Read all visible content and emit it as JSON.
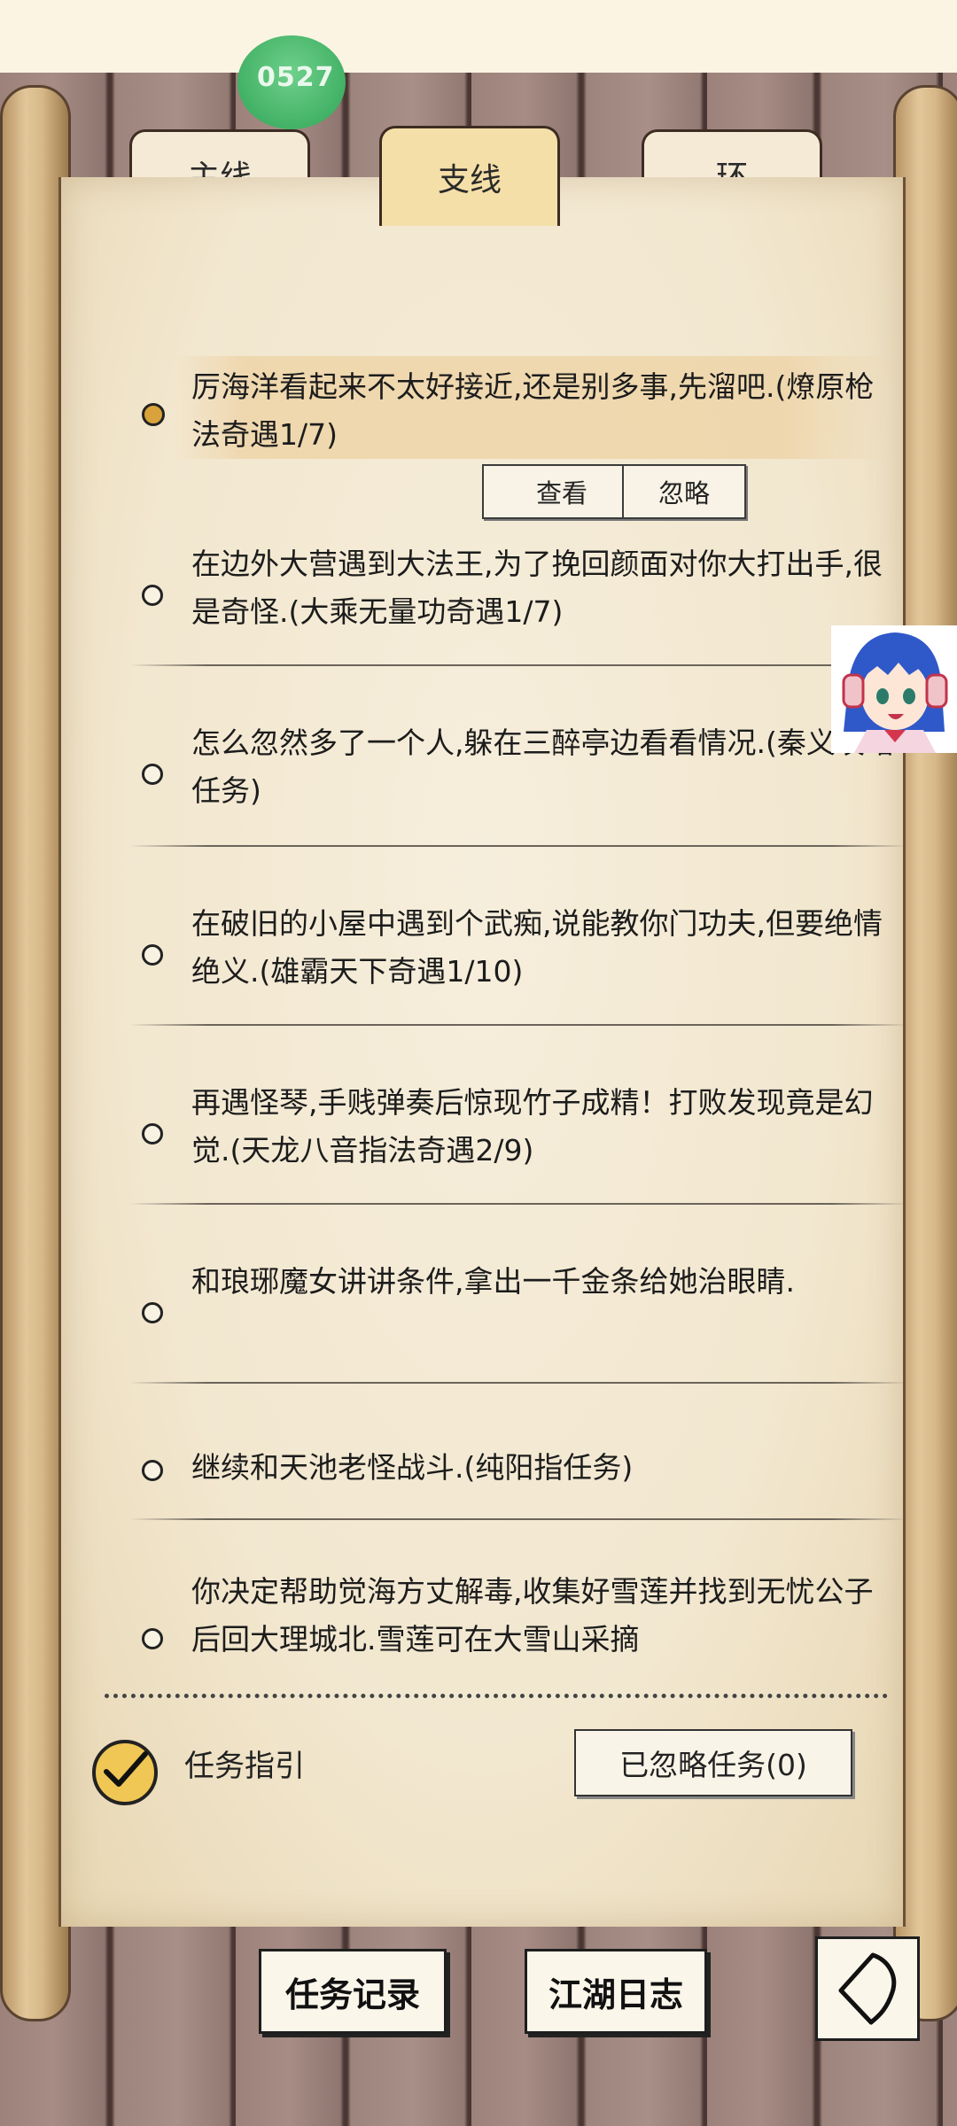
{
  "header": {
    "badge_text": "0527"
  },
  "tabs": [
    {
      "label": "主线",
      "active": false
    },
    {
      "label": "支线",
      "active": true
    },
    {
      "label": "环",
      "active": false
    }
  ],
  "quests": [
    {
      "text": "厉海洋看起来不太好接近,还是别多事,先溜吧.(燎原枪法奇遇1/7)",
      "selected": true
    },
    {
      "text": "在边外大营遇到大法王,为了挽回颜面对你大打出手,很是奇怪.(大乘无量功奇遇1/7)"
    },
    {
      "text": "怎么忽然多了一个人,躲在三醉亭边看看情况.(秦义攻略任务)"
    },
    {
      "text": "在破旧的小屋中遇到个武痴,说能教你门功夫,但要绝情绝义.(雄霸天下奇遇1/10)"
    },
    {
      "text": "再遇怪琴,手贱弹奏后惊现竹子成精！打败发现竟是幻觉.(天龙八音指法奇遇2/9)"
    },
    {
      "text": "和琅琊魔女讲讲条件,拿出一千金条给她治眼睛."
    },
    {
      "text": "继续和天池老怪战斗.(纯阳指任务)"
    },
    {
      "text": "你决定帮助觉海方丈解毒,收集好雪莲并找到无忧公子后回大理城北.雪莲可在大雪山采摘"
    }
  ],
  "quest_actions": {
    "view_label": "查看",
    "ignore_label": "忽略"
  },
  "footer": {
    "guide_label": "任务指引",
    "guide_checked": true,
    "ignored_button": "已忽略任务(0)"
  },
  "bottom_nav": {
    "record_label": "任务记录",
    "journal_label": "江湖日志"
  },
  "colors": {
    "paper": "#f2e7cf",
    "active_tab": "#f4dfa8",
    "active_bullet": "#d9a23a",
    "check_fill": "#f0c654"
  },
  "icons": {
    "back": "back-arrow-icon",
    "check": "checkmark-icon",
    "avatar": "anime-girl-avatar"
  }
}
